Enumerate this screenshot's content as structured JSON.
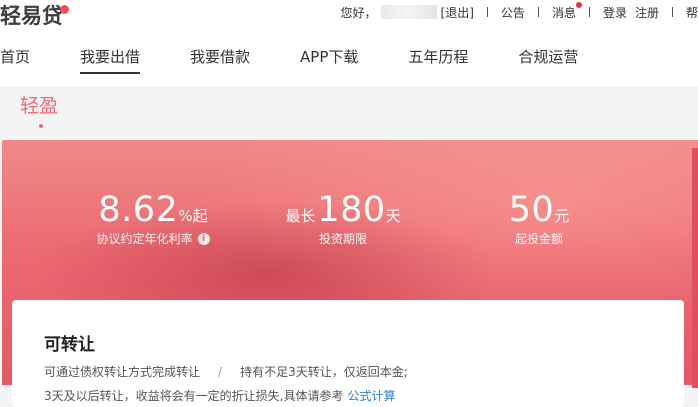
{
  "brand": {
    "name": "轻易贷",
    "accent": "#f0505a"
  },
  "topbar": {
    "greeting": "您好，",
    "logout": "[退出]",
    "notice": "公告",
    "messages": "消息",
    "login": "登录",
    "register": "注册",
    "cut_off": "帮"
  },
  "nav": [
    {
      "label": "首页",
      "active": false
    },
    {
      "label": "我要出借",
      "active": true
    },
    {
      "label": "我要借款",
      "active": false
    },
    {
      "label": "APP下载",
      "active": false
    },
    {
      "label": "五年历程",
      "active": false
    },
    {
      "label": "合规运营",
      "active": false
    }
  ],
  "product_tab": "轻盈",
  "stats": {
    "rate": {
      "value": "8.62",
      "unit": "%起",
      "caption": "协议约定年化利率"
    },
    "period": {
      "prefix": "最长",
      "value": "180",
      "unit": "天",
      "caption": "投资期限"
    },
    "min": {
      "value": "50",
      "unit": "元",
      "caption": "起投金额"
    }
  },
  "card": {
    "title": "可转让",
    "line1_a": "可通过债权转让方式完成转让",
    "line1_sep": "/",
    "line1_b": "持有不足3天转让，仅返回本金;",
    "line2": "3天及以后转让，收益将会有一定的折让损失,具体请参考",
    "link": "公式计算"
  },
  "colors": {
    "banner": "#ec6a72",
    "link": "#2f7fd6"
  }
}
